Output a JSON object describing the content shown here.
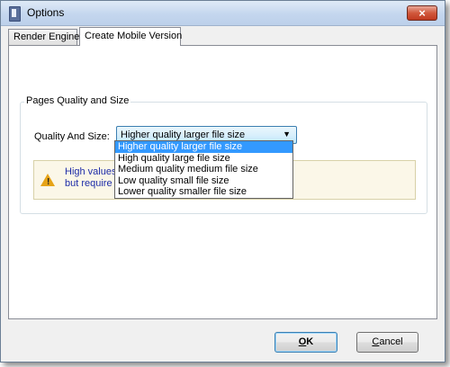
{
  "window": {
    "title": "Options",
    "close_label": "×"
  },
  "tabs": [
    {
      "label": "Render Engine"
    },
    {
      "label": "Create Mobile Version"
    }
  ],
  "group": {
    "title": "Pages Quality and Size",
    "quality_label": "Quality And Size:",
    "combo": {
      "selected": "Higher quality larger file size",
      "arrow": "▼"
    },
    "options": [
      "Higher quality larger file size",
      "High quality large file size",
      "Medium quality medium file size",
      "Low quality small file size",
      "Lower quality smaller file size"
    ],
    "warning": {
      "icon": "warning-icon",
      "mark": "!",
      "line1": "High values p",
      "line2": "but require m"
    }
  },
  "buttons": {
    "ok": {
      "accel": "O",
      "rest": "K"
    },
    "cancel": {
      "accel": "C",
      "rest": "ancel"
    }
  }
}
